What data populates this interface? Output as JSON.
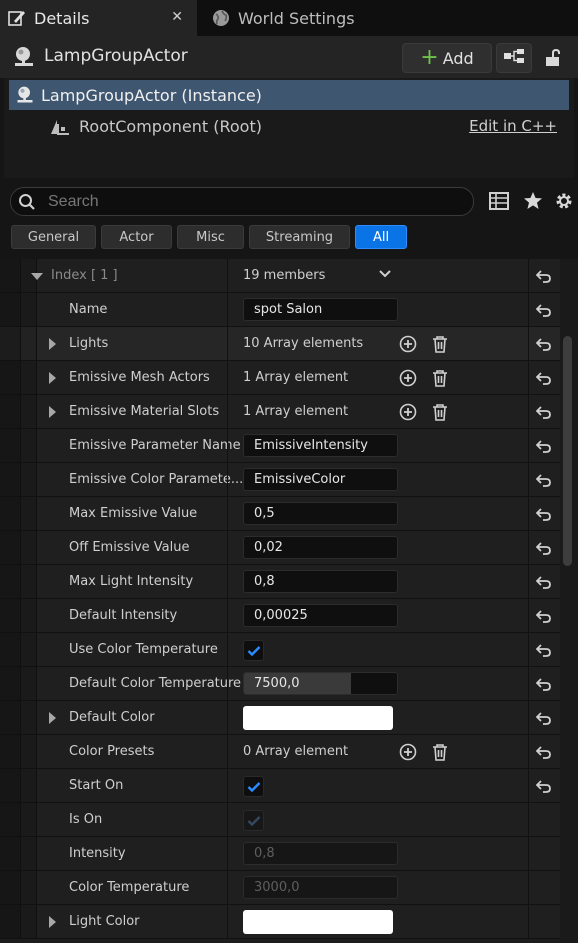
{
  "tabs": [
    {
      "label": "Details",
      "icon": "pencil-details-icon",
      "active": true,
      "close": "✕"
    },
    {
      "label": "World Settings",
      "icon": "globe-icon",
      "active": false
    }
  ],
  "header": {
    "title": "LampGroupActor",
    "add_label": "Add",
    "actor_icon": "actor-sphere-icon",
    "blueprint_icon": "hierarchy-icon",
    "lock_icon": "unlock-icon"
  },
  "components": {
    "instance": "LampGroupActor (Instance)",
    "root": "RootComponent (Root)",
    "edit_link": "Edit in C++"
  },
  "search": {
    "placeholder": "Search"
  },
  "filters": [
    "General",
    "Actor",
    "Misc",
    "Streaming",
    "All"
  ],
  "active_filter": "All",
  "grid": {
    "index_label": "Index",
    "index_value": "[ 1 ]",
    "index_members": "19 members",
    "rows": {
      "name": {
        "label": "Name",
        "value": "spot Salon"
      },
      "lights": {
        "label": "Lights",
        "value": "10 Array elements"
      },
      "emissive_mesh": {
        "label": "Emissive Mesh Actors",
        "value": "1 Array element"
      },
      "emissive_material": {
        "label": "Emissive Material Slots",
        "value": "1 Array element"
      },
      "emissive_param": {
        "label": "Emissive Parameter Name",
        "value": "EmissiveIntensity"
      },
      "emissive_color_param": {
        "label": "Emissive Color Paramete...",
        "value": "EmissiveColor"
      },
      "max_emissive": {
        "label": "Max Emissive Value",
        "value": "0,5"
      },
      "off_emissive": {
        "label": "Off Emissive Value",
        "value": "0,02"
      },
      "max_light": {
        "label": "Max Light Intensity",
        "value": "0,8"
      },
      "default_intensity": {
        "label": "Default Intensity",
        "value": "0,00025"
      },
      "use_color_temp": {
        "label": "Use Color Temperature",
        "checked": true
      },
      "default_color_temp": {
        "label": "Default Color Temperature",
        "value": "7500,0",
        "slider_fill": 0.7
      },
      "default_color": {
        "label": "Default Color",
        "color": "#ffffff"
      },
      "color_presets": {
        "label": "Color Presets",
        "value": "0 Array element"
      },
      "start_on": {
        "label": "Start On",
        "checked": true
      },
      "is_on": {
        "label": "Is On",
        "checked": true,
        "disabled": true
      },
      "intensity": {
        "label": "Intensity",
        "value": "0,8",
        "disabled": true
      },
      "color_temperature": {
        "label": "Color Temperature",
        "value": "3000,0",
        "disabled": true
      },
      "light_color": {
        "label": "Light Color",
        "color": "#ffffff"
      }
    }
  },
  "colors": {
    "accent": "#0a74e6",
    "selection": "#3f5670",
    "add_plus": "#6fc24a",
    "checkbox_blue": "#2a8cff"
  }
}
